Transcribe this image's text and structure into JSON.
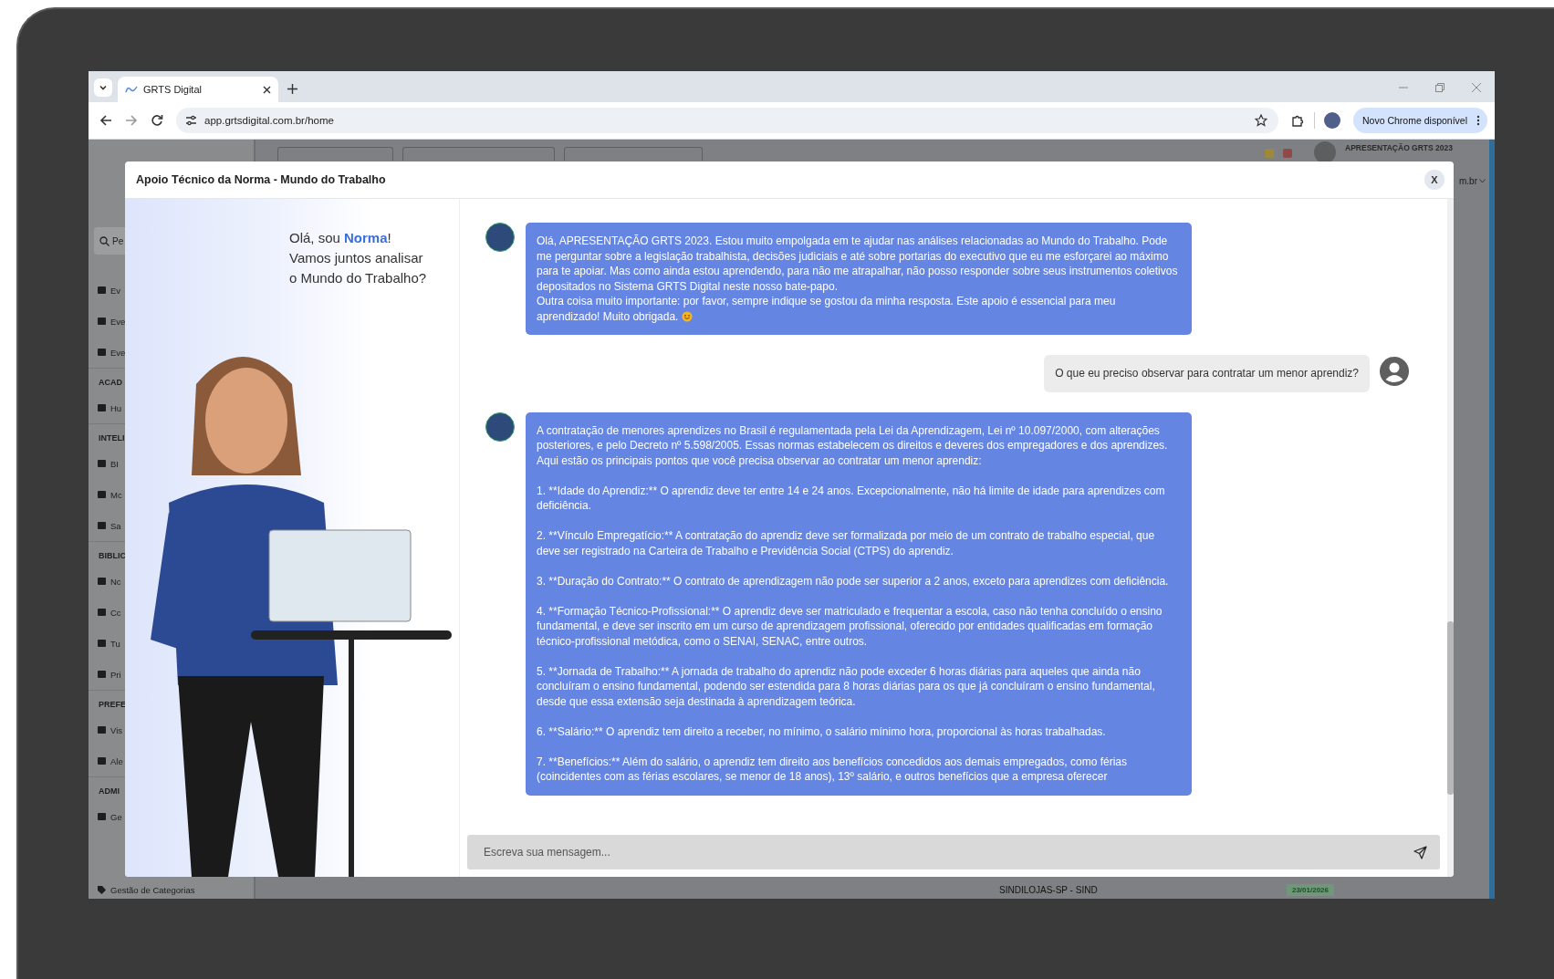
{
  "browser": {
    "tab_title": "GRTS Digital",
    "url": "app.grtsdigital.com.br/home",
    "update_button": "Novo Chrome disponível"
  },
  "background_page": {
    "user_name": "APRESENTAÇÃO GRTS 2023",
    "domain_fragment": "m.br",
    "search_fragment": "Pe",
    "sidebar": [
      {
        "kind": "item",
        "label": "Ev"
      },
      {
        "kind": "item",
        "label": "Eve"
      },
      {
        "kind": "item",
        "label": "Eve"
      },
      {
        "kind": "section",
        "label": "ACAD"
      },
      {
        "kind": "item",
        "label": "Hu"
      },
      {
        "kind": "section",
        "label": "INTELI"
      },
      {
        "kind": "item",
        "label": "BI"
      },
      {
        "kind": "item",
        "label": "Mc"
      },
      {
        "kind": "item",
        "label": "Sa"
      },
      {
        "kind": "section",
        "label": "BIBLIC"
      },
      {
        "kind": "item",
        "label": "Nc"
      },
      {
        "kind": "item",
        "label": "Cc"
      },
      {
        "kind": "item",
        "label": "Tu"
      },
      {
        "kind": "item",
        "label": "Pri"
      },
      {
        "kind": "section",
        "label": "PREFE"
      },
      {
        "kind": "item",
        "label": "Vis"
      },
      {
        "kind": "item",
        "label": "Ale"
      },
      {
        "kind": "section",
        "label": "ADMI"
      },
      {
        "kind": "item",
        "label": "Ge"
      }
    ],
    "sidebar_footer": "Gestão de Categorias",
    "list_row": {
      "name": "SINDILOJAS-SP - SIND",
      "date": "23/01/2026"
    }
  },
  "modal": {
    "title": "Apoio Técnico da Norma - Mundo do Trabalho",
    "close_label": "X",
    "greeting": {
      "before": "Olá, sou ",
      "name": "Norma",
      "after": "!",
      "lines": [
        "Vamos juntos analisar",
        "o Mundo do Trabalho?"
      ]
    },
    "messages": [
      {
        "kind": "bot",
        "smiley": true,
        "paragraphs": [
          "Olá, APRESENTAÇÃO GRTS 2023. Estou muito empolgada em te ajudar nas análises relacionadas ao Mundo do Trabalho. Pode me perguntar sobre a legislação trabalhista, decisões judiciais e até sobre portarias do executivo que eu me esforçarei ao máximo para te apoiar. Mas como ainda estou aprendendo, para não me atrapalhar, não posso responder sobre seus instrumentos coletivos depositados no Sistema GRTS Digital neste nosso bate-papo.\nOutra coisa muito importante: por favor, sempre indique se gostou da minha resposta. Este apoio é essencial para meu aprendizado! Muito obrigada."
        ]
      },
      {
        "kind": "user",
        "paragraphs": [
          "O que eu preciso observar para contratar um menor aprendiz?"
        ]
      },
      {
        "kind": "bot",
        "paragraphs": [
          "A contratação de menores aprendizes no Brasil é regulamentada pela Lei da Aprendizagem, Lei nº 10.097/2000, com alterações posteriores, e pelo Decreto nº 5.598/2005. Essas normas estabelecem os direitos e deveres dos empregadores e dos aprendizes. Aqui estão os principais pontos que você precisa observar ao contratar um menor aprendiz:",
          "1. **Idade do Aprendiz:** O aprendiz deve ter entre 14 e 24 anos. Excepcionalmente, não há limite de idade para aprendizes com deficiência.",
          "2. **Vínculo Empregatício:** A contratação do aprendiz deve ser formalizada por meio de um contrato de trabalho especial, que deve ser registrado na Carteira de Trabalho e Previdência Social (CTPS) do aprendiz.",
          "3. **Duração do Contrato:** O contrato de aprendizagem não pode ser superior a 2 anos, exceto para aprendizes com deficiência.",
          "4. **Formação Técnico-Profissional:** O aprendiz deve ser matriculado e frequentar a escola, caso não tenha concluído o ensino fundamental, e deve ser inscrito em um curso de aprendizagem profissional, oferecido por entidades qualificadas em formação técnico-profissional metódica, como o SENAI, SENAC, entre outros.",
          "5. **Jornada de Trabalho:** A jornada de trabalho do aprendiz não pode exceder 6 horas diárias para aqueles que ainda não concluíram o ensino fundamental, podendo ser estendida para 8 horas diárias para os que já concluíram o ensino fundamental, desde que essa extensão seja destinada à aprendizagem teórica.",
          "6. **Salário:** O aprendiz tem direito a receber, no mínimo, o salário mínimo hora, proporcional às horas trabalhadas.",
          "7. **Benefícios:** Além do salário, o aprendiz tem direito aos benefícios concedidos aos demais empregados, como férias (coincidentes com as férias escolares, se menor de 18 anos), 13º salário, e outros benefícios que a empresa oferecer"
        ]
      }
    ],
    "input": {
      "placeholder": "Escreva sua mensagem..."
    }
  }
}
